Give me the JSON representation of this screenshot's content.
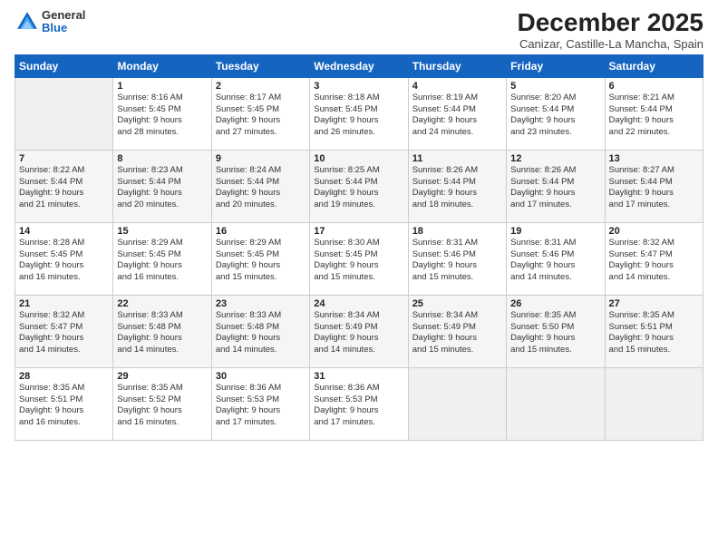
{
  "header": {
    "logo_general": "General",
    "logo_blue": "Blue",
    "month_title": "December 2025",
    "location": "Canizar, Castille-La Mancha, Spain"
  },
  "days_of_week": [
    "Sunday",
    "Monday",
    "Tuesday",
    "Wednesday",
    "Thursday",
    "Friday",
    "Saturday"
  ],
  "weeks": [
    [
      {
        "day": "",
        "info": ""
      },
      {
        "day": "1",
        "info": "Sunrise: 8:16 AM\nSunset: 5:45 PM\nDaylight: 9 hours\nand 28 minutes."
      },
      {
        "day": "2",
        "info": "Sunrise: 8:17 AM\nSunset: 5:45 PM\nDaylight: 9 hours\nand 27 minutes."
      },
      {
        "day": "3",
        "info": "Sunrise: 8:18 AM\nSunset: 5:45 PM\nDaylight: 9 hours\nand 26 minutes."
      },
      {
        "day": "4",
        "info": "Sunrise: 8:19 AM\nSunset: 5:44 PM\nDaylight: 9 hours\nand 24 minutes."
      },
      {
        "day": "5",
        "info": "Sunrise: 8:20 AM\nSunset: 5:44 PM\nDaylight: 9 hours\nand 23 minutes."
      },
      {
        "day": "6",
        "info": "Sunrise: 8:21 AM\nSunset: 5:44 PM\nDaylight: 9 hours\nand 22 minutes."
      }
    ],
    [
      {
        "day": "7",
        "info": "Sunrise: 8:22 AM\nSunset: 5:44 PM\nDaylight: 9 hours\nand 21 minutes."
      },
      {
        "day": "8",
        "info": "Sunrise: 8:23 AM\nSunset: 5:44 PM\nDaylight: 9 hours\nand 20 minutes."
      },
      {
        "day": "9",
        "info": "Sunrise: 8:24 AM\nSunset: 5:44 PM\nDaylight: 9 hours\nand 20 minutes."
      },
      {
        "day": "10",
        "info": "Sunrise: 8:25 AM\nSunset: 5:44 PM\nDaylight: 9 hours\nand 19 minutes."
      },
      {
        "day": "11",
        "info": "Sunrise: 8:26 AM\nSunset: 5:44 PM\nDaylight: 9 hours\nand 18 minutes."
      },
      {
        "day": "12",
        "info": "Sunrise: 8:26 AM\nSunset: 5:44 PM\nDaylight: 9 hours\nand 17 minutes."
      },
      {
        "day": "13",
        "info": "Sunrise: 8:27 AM\nSunset: 5:44 PM\nDaylight: 9 hours\nand 17 minutes."
      }
    ],
    [
      {
        "day": "14",
        "info": "Sunrise: 8:28 AM\nSunset: 5:45 PM\nDaylight: 9 hours\nand 16 minutes."
      },
      {
        "day": "15",
        "info": "Sunrise: 8:29 AM\nSunset: 5:45 PM\nDaylight: 9 hours\nand 16 minutes."
      },
      {
        "day": "16",
        "info": "Sunrise: 8:29 AM\nSunset: 5:45 PM\nDaylight: 9 hours\nand 15 minutes."
      },
      {
        "day": "17",
        "info": "Sunrise: 8:30 AM\nSunset: 5:45 PM\nDaylight: 9 hours\nand 15 minutes."
      },
      {
        "day": "18",
        "info": "Sunrise: 8:31 AM\nSunset: 5:46 PM\nDaylight: 9 hours\nand 15 minutes."
      },
      {
        "day": "19",
        "info": "Sunrise: 8:31 AM\nSunset: 5:46 PM\nDaylight: 9 hours\nand 14 minutes."
      },
      {
        "day": "20",
        "info": "Sunrise: 8:32 AM\nSunset: 5:47 PM\nDaylight: 9 hours\nand 14 minutes."
      }
    ],
    [
      {
        "day": "21",
        "info": "Sunrise: 8:32 AM\nSunset: 5:47 PM\nDaylight: 9 hours\nand 14 minutes."
      },
      {
        "day": "22",
        "info": "Sunrise: 8:33 AM\nSunset: 5:48 PM\nDaylight: 9 hours\nand 14 minutes."
      },
      {
        "day": "23",
        "info": "Sunrise: 8:33 AM\nSunset: 5:48 PM\nDaylight: 9 hours\nand 14 minutes."
      },
      {
        "day": "24",
        "info": "Sunrise: 8:34 AM\nSunset: 5:49 PM\nDaylight: 9 hours\nand 14 minutes."
      },
      {
        "day": "25",
        "info": "Sunrise: 8:34 AM\nSunset: 5:49 PM\nDaylight: 9 hours\nand 15 minutes."
      },
      {
        "day": "26",
        "info": "Sunrise: 8:35 AM\nSunset: 5:50 PM\nDaylight: 9 hours\nand 15 minutes."
      },
      {
        "day": "27",
        "info": "Sunrise: 8:35 AM\nSunset: 5:51 PM\nDaylight: 9 hours\nand 15 minutes."
      }
    ],
    [
      {
        "day": "28",
        "info": "Sunrise: 8:35 AM\nSunset: 5:51 PM\nDaylight: 9 hours\nand 16 minutes."
      },
      {
        "day": "29",
        "info": "Sunrise: 8:35 AM\nSunset: 5:52 PM\nDaylight: 9 hours\nand 16 minutes."
      },
      {
        "day": "30",
        "info": "Sunrise: 8:36 AM\nSunset: 5:53 PM\nDaylight: 9 hours\nand 17 minutes."
      },
      {
        "day": "31",
        "info": "Sunrise: 8:36 AM\nSunset: 5:53 PM\nDaylight: 9 hours\nand 17 minutes."
      },
      {
        "day": "",
        "info": ""
      },
      {
        "day": "",
        "info": ""
      },
      {
        "day": "",
        "info": ""
      }
    ]
  ]
}
